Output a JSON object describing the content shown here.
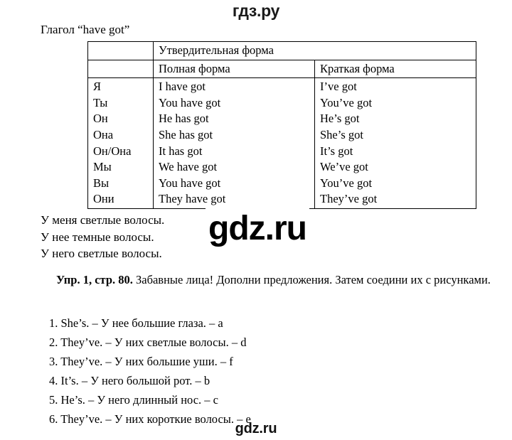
{
  "site": {
    "top_logo": "гдз.ру",
    "watermark_overlay": "gdz.ru",
    "watermark_bottom": "gdz.ru"
  },
  "heading": "Глагол “have got”",
  "table": {
    "header_span": "Утвердительная форма",
    "col_full": "Полная форма",
    "col_short": "Краткая форма",
    "rows": [
      {
        "pronoun": "Я",
        "full": "I have got",
        "short": "I’ve got"
      },
      {
        "pronoun": "Ты",
        "full": "You have got",
        "short": "You’ve got"
      },
      {
        "pronoun": "Он",
        "full": "He has got",
        "short": "He’s got"
      },
      {
        "pronoun": "Она",
        "full": "She has got",
        "short": "She’s got"
      },
      {
        "pronoun": "Он/Она",
        "full": "It has got",
        "short": "It’s got"
      },
      {
        "pronoun": "Мы",
        "full": "We have got",
        "short": "We’ve got"
      },
      {
        "pronoun": "Вы",
        "full": "You have got",
        "short": "You’ve got"
      },
      {
        "pronoun": "Они",
        "full": "They have got",
        "short": "They’ve got"
      }
    ]
  },
  "examples": [
    "У меня светлые волосы.",
    "У нее темные волосы.",
    "У него светлые волосы."
  ],
  "exercise": {
    "label": "Упр. 1, стр. 80.",
    "text": " Забавные лица! Дополни предложения. Затем соедини их с рисунками."
  },
  "answers": [
    "1. She’s. – У нее большие глаза. – a",
    "2. They’ve. – У них светлые волосы. – d",
    "3. They’ve. – У них большие уши. – f",
    "4. It’s. – У него большой рот. – b",
    "5. He’s. – У него длинный нос. – c",
    "6. They’ve. – У них короткие волосы. – e"
  ]
}
